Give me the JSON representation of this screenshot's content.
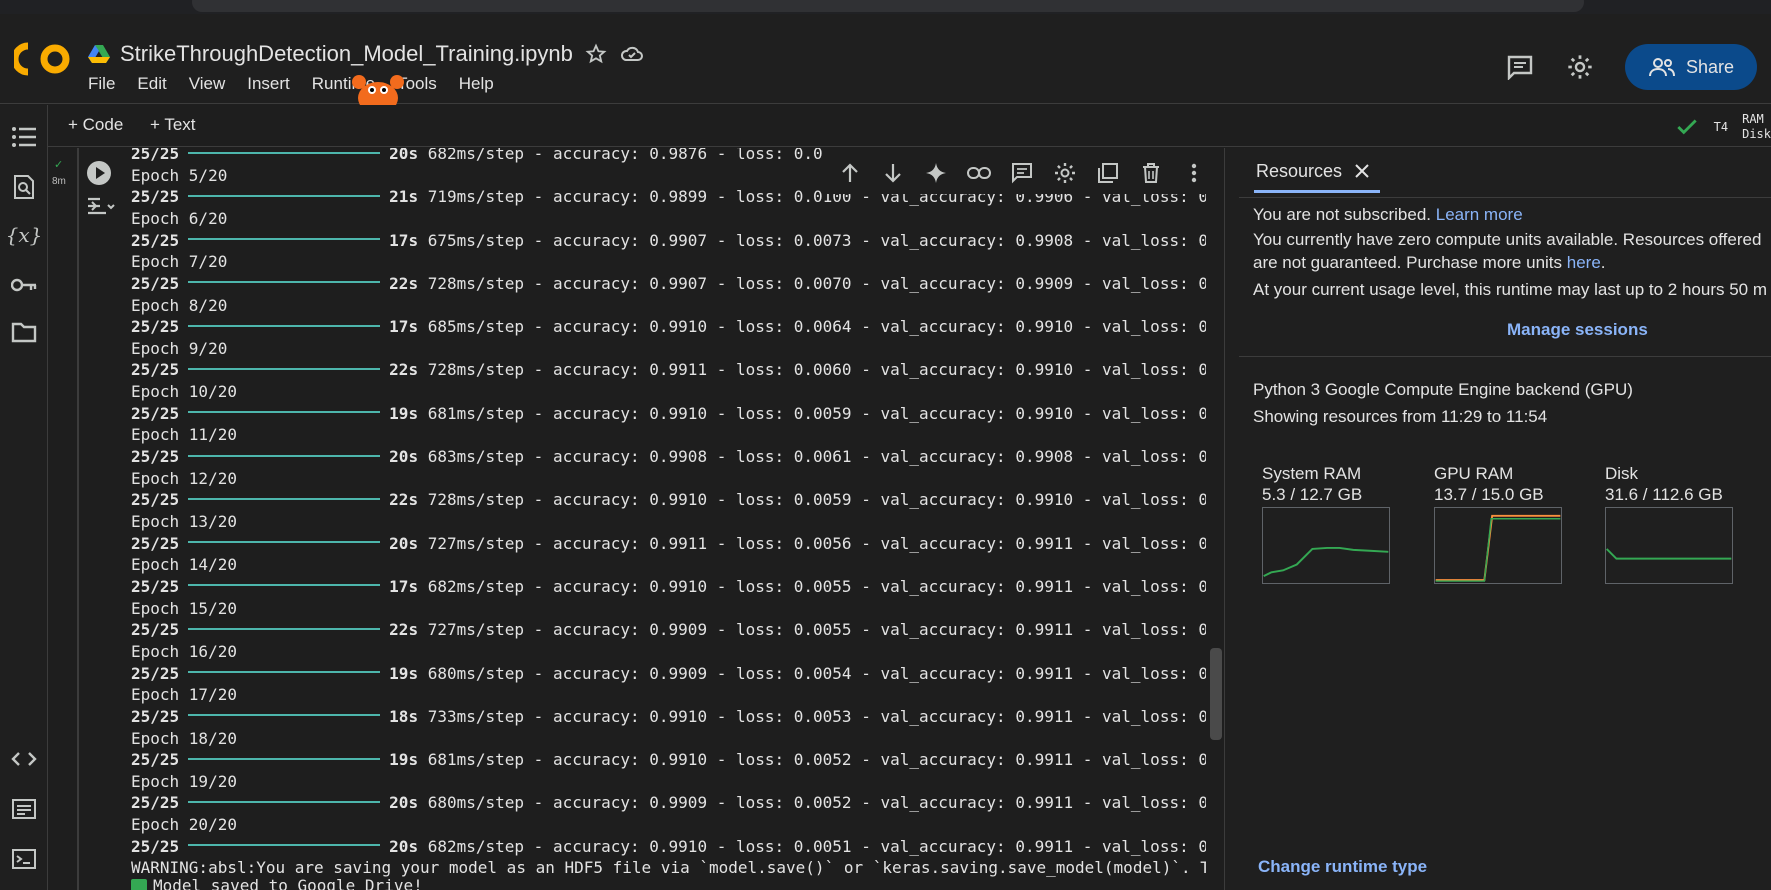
{
  "app": {
    "logo_text": "CO",
    "doc_title": "StrikeThroughDetection_Model_Training.ipynb",
    "menu": [
      "File",
      "Edit",
      "View",
      "Insert",
      "Runtime",
      "Tools",
      "Help"
    ],
    "share_label": "Share"
  },
  "toolbar": {
    "add_code": "+ Code",
    "add_text": "+ Text",
    "runtime_type": "T4",
    "ram_label": "RAM",
    "disk_label": "Disk"
  },
  "cell": {
    "exec_time": "8m",
    "header_line": {
      "step": "25/25",
      "secs": "20s",
      "rest": "682ms/step - accuracy: 0.9876 - loss: 0.0"
    },
    "epochs": [
      {
        "epoch": "Epoch 5/20",
        "step": "25/25",
        "secs": "21s",
        "rest": "719ms/step - accuracy: 0.9899 - loss: 0.0100 - val_accuracy: 0.9906 - val_loss: 0"
      },
      {
        "epoch": "Epoch 6/20",
        "step": "25/25",
        "secs": "17s",
        "rest": "675ms/step - accuracy: 0.9907 - loss: 0.0073 - val_accuracy: 0.9908 - val_loss: 0"
      },
      {
        "epoch": "Epoch 7/20",
        "step": "25/25",
        "secs": "22s",
        "rest": "728ms/step - accuracy: 0.9907 - loss: 0.0070 - val_accuracy: 0.9909 - val_loss: 0"
      },
      {
        "epoch": "Epoch 8/20",
        "step": "25/25",
        "secs": "17s",
        "rest": "685ms/step - accuracy: 0.9910 - loss: 0.0064 - val_accuracy: 0.9910 - val_loss: 0"
      },
      {
        "epoch": "Epoch 9/20",
        "step": "25/25",
        "secs": "22s",
        "rest": "728ms/step - accuracy: 0.9911 - loss: 0.0060 - val_accuracy: 0.9910 - val_loss: 0"
      },
      {
        "epoch": "Epoch 10/20",
        "step": "25/25",
        "secs": "19s",
        "rest": "681ms/step - accuracy: 0.9910 - loss: 0.0059 - val_accuracy: 0.9910 - val_loss: 0"
      },
      {
        "epoch": "Epoch 11/20",
        "step": "25/25",
        "secs": "20s",
        "rest": "683ms/step - accuracy: 0.9908 - loss: 0.0061 - val_accuracy: 0.9908 - val_loss: 0"
      },
      {
        "epoch": "Epoch 12/20",
        "step": "25/25",
        "secs": "22s",
        "rest": "728ms/step - accuracy: 0.9910 - loss: 0.0059 - val_accuracy: 0.9910 - val_loss: 0"
      },
      {
        "epoch": "Epoch 13/20",
        "step": "25/25",
        "secs": "20s",
        "rest": "727ms/step - accuracy: 0.9911 - loss: 0.0056 - val_accuracy: 0.9911 - val_loss: 0"
      },
      {
        "epoch": "Epoch 14/20",
        "step": "25/25",
        "secs": "17s",
        "rest": "682ms/step - accuracy: 0.9910 - loss: 0.0055 - val_accuracy: 0.9911 - val_loss: 0"
      },
      {
        "epoch": "Epoch 15/20",
        "step": "25/25",
        "secs": "22s",
        "rest": "727ms/step - accuracy: 0.9909 - loss: 0.0055 - val_accuracy: 0.9911 - val_loss: 0"
      },
      {
        "epoch": "Epoch 16/20",
        "step": "25/25",
        "secs": "19s",
        "rest": "680ms/step - accuracy: 0.9909 - loss: 0.0054 - val_accuracy: 0.9911 - val_loss: 0"
      },
      {
        "epoch": "Epoch 17/20",
        "step": "25/25",
        "secs": "18s",
        "rest": "733ms/step - accuracy: 0.9910 - loss: 0.0053 - val_accuracy: 0.9911 - val_loss: 0"
      },
      {
        "epoch": "Epoch 18/20",
        "step": "25/25",
        "secs": "19s",
        "rest": "681ms/step - accuracy: 0.9910 - loss: 0.0052 - val_accuracy: 0.9911 - val_loss: 0"
      },
      {
        "epoch": "Epoch 19/20",
        "step": "25/25",
        "secs": "20s",
        "rest": "680ms/step - accuracy: 0.9909 - loss: 0.0052 - val_accuracy: 0.9911 - val_loss: 0"
      },
      {
        "epoch": "Epoch 20/20",
        "step": "25/25",
        "secs": "20s",
        "rest": "682ms/step - accuracy: 0.9910 - loss: 0.0051 - val_accuracy: 0.9911 - val_loss: 0"
      }
    ],
    "warning": "WARNING:absl:You are saving your model as an HDF5 file via `model.save()` or `keras.saving.save_model(model)`. T",
    "saved_msg": "Model saved to Google Drive!"
  },
  "resources": {
    "tab_label": "Resources",
    "not_subscribed": "You are not subscribed.",
    "learn_more": "Learn more",
    "zero_units_1": "You currently have zero compute units available. Resources offered",
    "zero_units_2": "are not guaranteed. Purchase more units",
    "here": "here",
    "period": ".",
    "usage_level": "At your current usage level, this runtime may last up to 2 hours 50 m",
    "manage_sessions": "Manage sessions",
    "backend": "Python 3 Google Compute Engine backend (GPU)",
    "showing": "Showing resources from 11:29 to 11:54",
    "system_ram_label": "System RAM",
    "system_ram_value": "5.3 / 12.7 GB",
    "gpu_ram_label": "GPU RAM",
    "gpu_ram_value": "13.7 / 15.0 GB",
    "disk_label": "Disk",
    "disk_value": "31.6 / 112.6 GB",
    "change_runtime": "Change runtime type"
  },
  "colors": {
    "accent": "#8ab4f8",
    "progress": "#4db6ac",
    "ok": "#34a853",
    "share_bg": "#0b4a8b"
  }
}
